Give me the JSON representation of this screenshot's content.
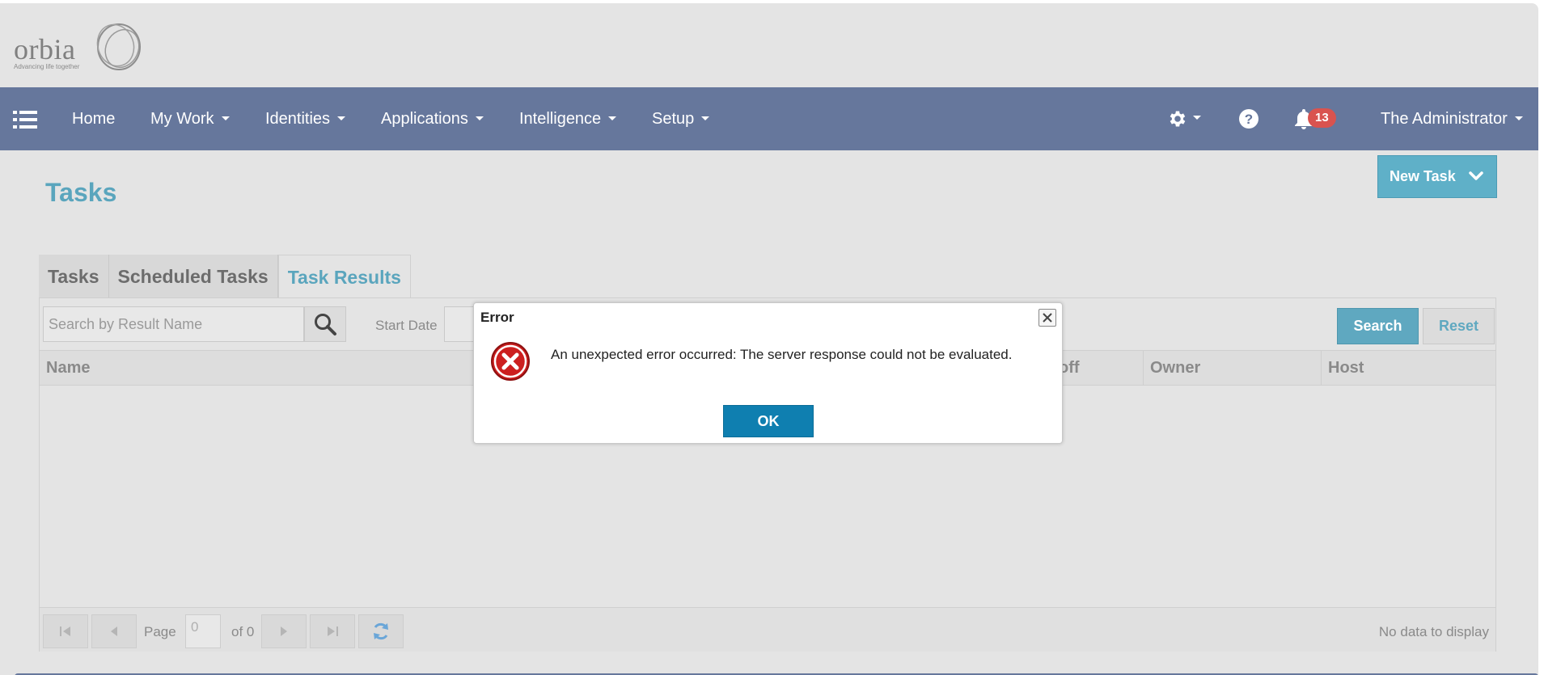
{
  "brand": {
    "name": "orbia",
    "tagline": "Advancing life together"
  },
  "nav": {
    "items": [
      {
        "label": "Home",
        "has_caret": false
      },
      {
        "label": "My Work",
        "has_caret": true
      },
      {
        "label": "Identities",
        "has_caret": true
      },
      {
        "label": "Applications",
        "has_caret": true
      },
      {
        "label": "Intelligence",
        "has_caret": true
      },
      {
        "label": "Setup",
        "has_caret": true
      }
    ],
    "notifications_count": "13",
    "user": "The Administrator",
    "icons": [
      "list-menu-icon",
      "gear-icon",
      "help-icon",
      "bell-icon"
    ]
  },
  "page": {
    "title": "Tasks",
    "new_task_label": "New Task"
  },
  "tabs": [
    {
      "label": "Tasks",
      "active": false
    },
    {
      "label": "Scheduled Tasks",
      "active": false
    },
    {
      "label": "Task Results",
      "active": true
    }
  ],
  "filters": {
    "search_placeholder": "Search by Result Name",
    "start_date_label": "Start Date",
    "search_button": "Search",
    "reset_button": "Reset"
  },
  "grid": {
    "columns": [
      "Name",
      "off",
      "Owner",
      "Host"
    ]
  },
  "pager": {
    "page_label": "Page",
    "page_value": "0",
    "of_label": "of 0",
    "status": "No data to display"
  },
  "dialog": {
    "title": "Error",
    "message": "An unexpected error occurred: The server response could not be evaluated.",
    "ok_label": "OK"
  },
  "colors": {
    "navbar": "#66779c",
    "accent": "#5aa5bd",
    "badge": "#d9534f",
    "ok_button": "#0f7fb0",
    "error_icon": "#cc1f1f"
  }
}
